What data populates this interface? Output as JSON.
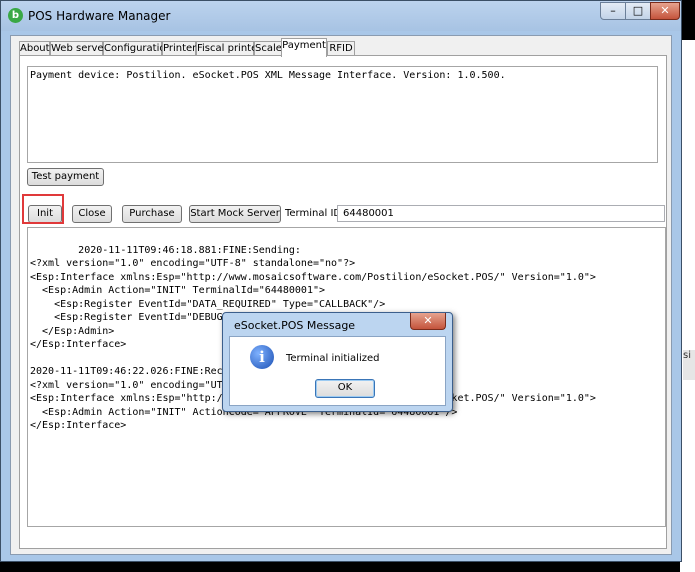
{
  "window": {
    "title": "POS Hardware Manager",
    "min_label": "–",
    "max_label": "□",
    "close_label": "✕",
    "app_icon": "b"
  },
  "tabs": [
    "About",
    "Web server",
    "Configuration",
    "Printer",
    "Fiscal printer",
    "Scale",
    "Payment",
    "RFID"
  ],
  "active_tab": "Payment",
  "info_text": "Payment device: Postilion. eSocket.POS XML Message Interface. Version: 1.0.500.",
  "buttons": {
    "test_payment": "Test payment",
    "init": "Init",
    "close": "Close",
    "purchase": "Purchase",
    "start_mock": "Start Mock Server"
  },
  "terminal": {
    "label": "Terminal ID",
    "value": "64480001"
  },
  "log_text": "2020-11-11T09:46:18.881:FINE:Sending:\n<?xml version=\"1.0\" encoding=\"UTF-8\" standalone=\"no\"?>\n<Esp:Interface xmlns:Esp=\"http://www.mosaicsoftware.com/Postilion/eSocket.POS/\" Version=\"1.0\">\n  <Esp:Admin Action=\"INIT\" TerminalId=\"64480001\">\n    <Esp:Register EventId=\"DATA_REQUIRED\" Type=\"CALLBACK\"/>\n    <Esp:Register EventId=\"DEBUG_ALL\" Type=\"EVENT\"/>\n  </Esp:Admin>\n</Esp:Interface>\n\n2020-11-11T09:46:22.026:FINE:Receiving:\n<?xml version=\"1.0\" encoding=\"UTF-8\" standalone=\"no\"?>\n<Esp:Interface xmlns:Esp=\"http://www.mosaicsoftware.com/Postilion/eSocket.POS/\" Version=\"1.0\">\n  <Esp:Admin Action=\"INIT\" ActionCode=\"APPROVE\" TerminalId=\"64480001\"/>\n</Esp:Interface>",
  "dialog": {
    "title": "eSocket.POS Message",
    "message": "Terminal initialized",
    "ok": "OK",
    "close_label": "✕",
    "icon_glyph": "i"
  },
  "background_fragment": "si"
}
